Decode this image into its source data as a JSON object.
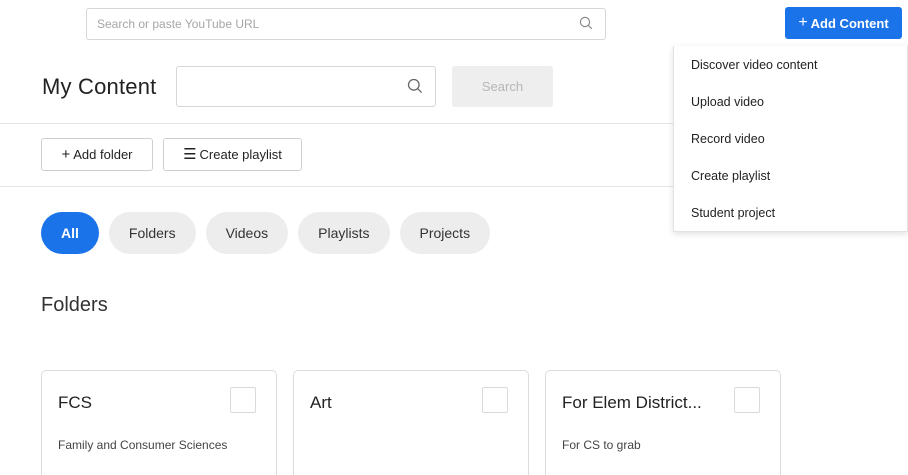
{
  "topbar": {
    "search_placeholder": "Search or paste YouTube URL",
    "search_icon": "search-icon",
    "add_content_label": "Add Content",
    "add_content_plus": "+"
  },
  "header": {
    "title": "My Content",
    "search_value": "",
    "search_button_label": "Search"
  },
  "toolbar": {
    "add_folder_glyph": "+",
    "add_folder_label": "Add folder",
    "create_playlist_glyph": "☰",
    "create_playlist_label": "Create playlist"
  },
  "filters": [
    {
      "label": "All",
      "active": true
    },
    {
      "label": "Folders",
      "active": false
    },
    {
      "label": "Videos",
      "active": false
    },
    {
      "label": "Playlists",
      "active": false
    },
    {
      "label": "Projects",
      "active": false
    }
  ],
  "folders_section": {
    "title": "Folders",
    "cards": [
      {
        "title": "FCS",
        "description": "Family and Consumer Sciences"
      },
      {
        "title": "Art",
        "description": ""
      },
      {
        "title": "For Elem District...",
        "description": "For CS to grab"
      }
    ]
  },
  "add_menu": {
    "items": [
      {
        "label": "Discover video content"
      },
      {
        "label": "Upload video"
      },
      {
        "label": "Record video"
      },
      {
        "label": "Create playlist"
      },
      {
        "label": "Student project"
      }
    ]
  },
  "colors": {
    "accent": "#1a73e8",
    "pill_inactive": "#ededed",
    "search_button_bg": "#eeeeee"
  }
}
